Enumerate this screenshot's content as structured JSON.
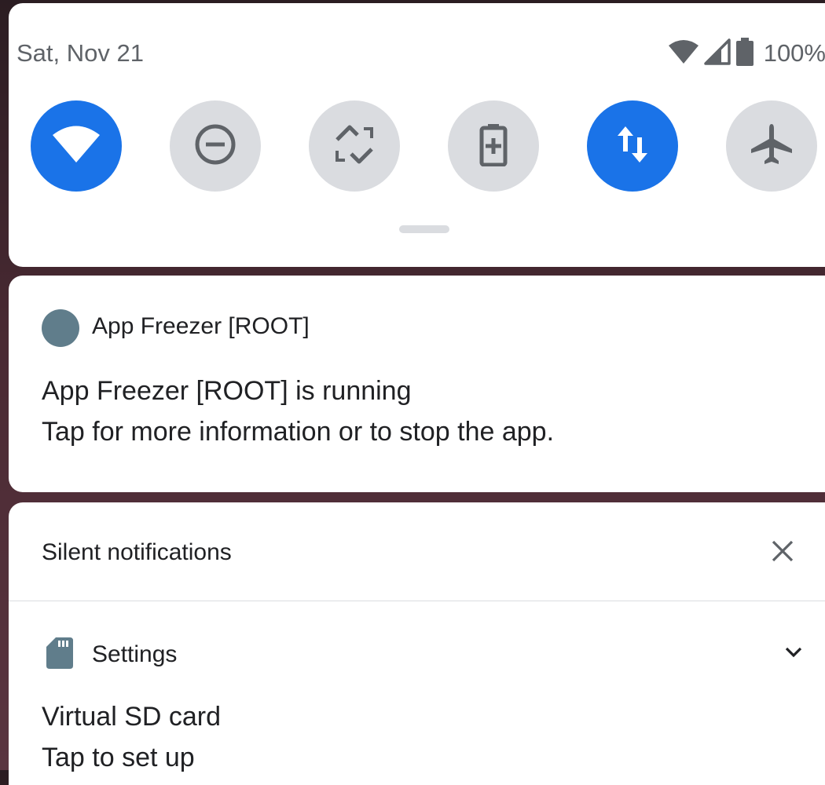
{
  "status_bar": {
    "date": "Sat, Nov 21",
    "battery_percent": "100%",
    "icons": [
      "wifi-signal-icon",
      "cell-signal-icon",
      "battery-icon"
    ]
  },
  "quick_settings": {
    "tiles": [
      {
        "name": "wifi",
        "icon": "wifi-icon",
        "state": "on"
      },
      {
        "name": "do-not-disturb",
        "icon": "minus-circle-icon",
        "state": "off"
      },
      {
        "name": "auto-rotate",
        "icon": "rotate-icon",
        "state": "off"
      },
      {
        "name": "battery-saver",
        "icon": "battery-plus-icon",
        "state": "off"
      },
      {
        "name": "mobile-data",
        "icon": "data-arrows-icon",
        "state": "on"
      },
      {
        "name": "airplane-mode",
        "icon": "airplane-icon",
        "state": "off"
      }
    ],
    "colors": {
      "on": "#1a73e8",
      "off": "#dadce0"
    }
  },
  "notification_running": {
    "app_name": "App Freezer [ROOT]",
    "title": "App Freezer [ROOT] is running",
    "text": "Tap for more information or to stop the app."
  },
  "silent_section": {
    "header": "Silent notifications",
    "notification": {
      "app_name": "Settings",
      "title": "Virtual SD card",
      "text": "Tap to set up"
    }
  }
}
